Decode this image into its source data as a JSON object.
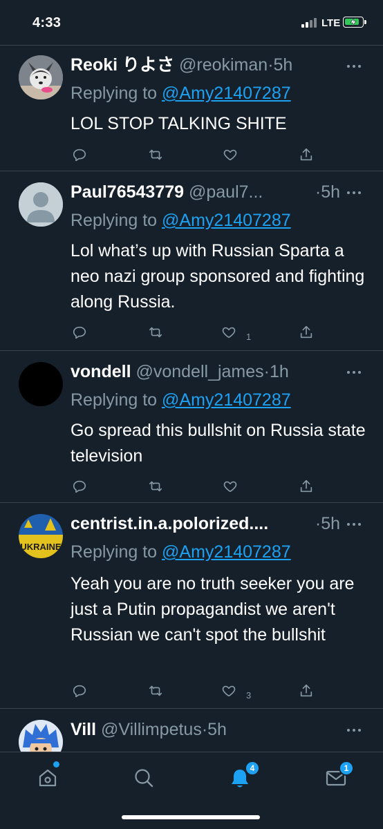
{
  "status_bar": {
    "time": "4:33",
    "network": "LTE"
  },
  "tweets": [
    {
      "name": "Reoki りよさ",
      "handle": "@reokiman",
      "time": "5h",
      "replying_label": "Replying to",
      "replying_to": "@Amy21407287",
      "text": "LOL STOP TALKING SHITE",
      "like_count": ""
    },
    {
      "name": "Paul76543779",
      "handle": "@paul7...",
      "time": "5h",
      "replying_label": "Replying to",
      "replying_to": "@Amy21407287",
      "text": "Lol what’s up with Russian Sparta a neo nazi group sponsored and fighting along Russia.",
      "like_count": "1"
    },
    {
      "name": "vondell",
      "handle": "@vondell_james",
      "time": "1h",
      "replying_label": "Replying to",
      "replying_to": "@Amy21407287",
      "text": "Go spread this bullshit on Russia state television",
      "like_count": ""
    },
    {
      "name": "centrist.in.a.polorized....",
      "handle": "",
      "time": "5h",
      "replying_label": "Replying to",
      "replying_to": "@Amy21407287",
      "text": "Yeah you are no truth seeker you are just a Putin propagandist we aren't Russian we can't spot the bullshit",
      "like_count": "3",
      "avatar_text": "UKRAINE"
    },
    {
      "name": "Vill",
      "handle": "@Villimpetus",
      "time": "5h"
    }
  ],
  "bottom_nav": {
    "notifications_badge": "4",
    "messages_badge": "1"
  },
  "colors": {
    "background": "#15202b",
    "accent": "#1da1f2",
    "secondary_text": "#8899a6",
    "divider": "#38444d",
    "battery": "#34c759"
  }
}
